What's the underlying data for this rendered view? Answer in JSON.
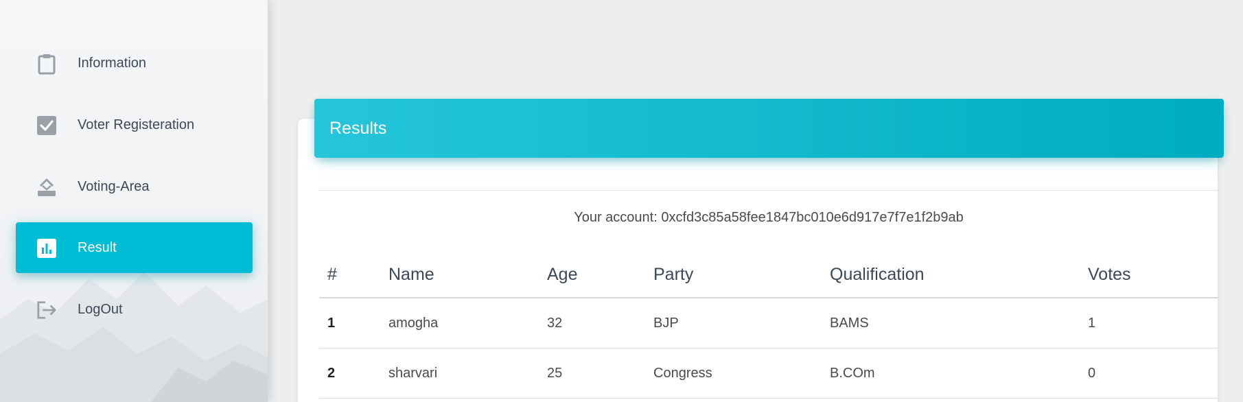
{
  "sidebar": {
    "items": [
      {
        "label": "Information",
        "icon": "clipboard-icon",
        "active": false
      },
      {
        "label": "Voter Registeration",
        "icon": "checkbox-icon",
        "active": false
      },
      {
        "label": "Voting-Area",
        "icon": "ballot-icon",
        "active": false
      },
      {
        "label": "Result",
        "icon": "bar-chart-icon",
        "active": true
      },
      {
        "label": "LogOut",
        "icon": "logout-icon",
        "active": false
      }
    ]
  },
  "results": {
    "title": "Results",
    "account_label": "Your account:",
    "account_value": "0xcfd3c85a58fee1847bc010e6d917e7f7e1f2b9ab",
    "columns": [
      "#",
      "Name",
      "Age",
      "Party",
      "Qualification",
      "Votes"
    ],
    "rows": [
      [
        "1",
        "amogha",
        "32",
        "BJP",
        "BAMS",
        "1"
      ],
      [
        "2",
        "sharvari",
        "25",
        "Congress",
        "B.COm",
        "0"
      ]
    ]
  },
  "colors": {
    "accent": "#00bcd4",
    "header_gradient_start": "#26c6da",
    "header_gradient_end": "#00acc1"
  }
}
